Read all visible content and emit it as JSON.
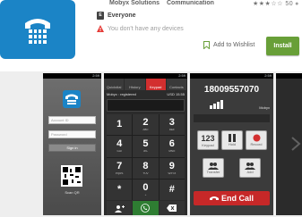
{
  "app": {
    "developer": "Mobyx Solutions",
    "category": "Communication",
    "rating_text": "★★★☆☆",
    "rating_count": "50",
    "content_rating": "Everyone",
    "warning": "You don't have any devices",
    "wishlist_label": "Add to Wishlist",
    "install_label": "Install",
    "brand_color": "#1b84c6",
    "install_color": "#689f38"
  },
  "screens": {
    "login": {
      "status_time": "2:59",
      "username_placeholder": "Account ID",
      "password_placeholder": "Password",
      "signin_label": "Sign in",
      "qr_label": "Scan QR"
    },
    "dialpad": {
      "status_time": "2:59",
      "tabs": [
        "Quickdial",
        "History",
        "Keypad",
        "Contacts"
      ],
      "account_label": "Mobyx : registered",
      "balance": "USD 15.55",
      "keys": [
        {
          "digit": "1",
          "letters": ""
        },
        {
          "digit": "2",
          "letters": "ABC"
        },
        {
          "digit": "3",
          "letters": "DEF"
        },
        {
          "digit": "4",
          "letters": "GHI"
        },
        {
          "digit": "5",
          "letters": "JKL"
        },
        {
          "digit": "6",
          "letters": "MNO"
        },
        {
          "digit": "7",
          "letters": "PQRS"
        },
        {
          "digit": "8",
          "letters": "TUV"
        },
        {
          "digit": "9",
          "letters": "WXYZ"
        },
        {
          "digit": "*",
          "letters": ""
        },
        {
          "digit": "0",
          "letters": "+"
        },
        {
          "digit": "#",
          "letters": ""
        }
      ]
    },
    "incall": {
      "status_time": "2:59",
      "number": "18009557070",
      "brand": "Mobyx",
      "controls": [
        "Keypad",
        "Hold",
        "Record",
        "Transfer",
        "Add"
      ],
      "keypad_label": "123",
      "end_call_label": "End Call"
    }
  }
}
